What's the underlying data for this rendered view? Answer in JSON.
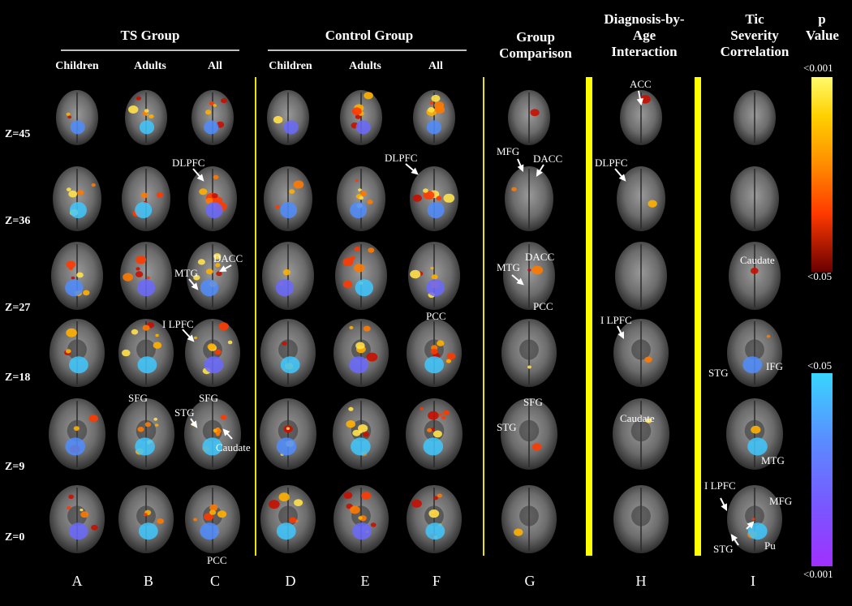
{
  "headers": {
    "ts_group": "TS Group",
    "control_group": "Control Group",
    "group_comparison": [
      "Group",
      "Comparison"
    ],
    "diagnosis_by_age": [
      "Diagnosis-by-",
      "Age",
      "Interaction"
    ],
    "tic_severity": [
      "Tic",
      "Severity",
      "Correlation"
    ],
    "p_value": [
      "p",
      "Value"
    ]
  },
  "subheaders": [
    "Children",
    "Adults",
    "All",
    "Children",
    "Adults",
    "All"
  ],
  "z_labels": [
    "Z=45",
    "Z=36",
    "Z=27",
    "Z=18",
    "Z=9",
    "Z=0"
  ],
  "column_letters": [
    "A",
    "B",
    "C",
    "D",
    "E",
    "F",
    "G",
    "H",
    "I"
  ],
  "colorbar": {
    "positive": {
      "top": "<0.001",
      "bottom": "<0.05",
      "colors": [
        "#fffb6a",
        "#ffd000",
        "#ff8c00",
        "#ff4a00",
        "#d01000",
        "#6a0000"
      ]
    },
    "negative": {
      "top": "<0.05",
      "bottom": "<0.001",
      "colors": [
        "#38d6ff",
        "#5a8cff",
        "#7a55ff",
        "#a030ff"
      ]
    }
  },
  "annotations": {
    "dlpfc_c": "DLPFC",
    "dacc_c": "DACC",
    "mtg_c": "MTG",
    "ilpfc_c": "I LPFC",
    "sfg_b": "SFG",
    "stg_c": "STG",
    "sfg_c": "SFG",
    "caudate_c": "Caudate",
    "pcc_c": "PCC",
    "dlpfc_f": "DLPFC",
    "pcc_f": "PCC",
    "mfg_g": "MFG",
    "dacc_g1": "DACC",
    "dacc_g2": "DACC",
    "mtg_g": "MTG",
    "pcc_g": "PCC",
    "sfg_g": "SFG",
    "stg_g": "STG",
    "acc_h": "ACC",
    "dlpfc_h": "DLPFC",
    "ilpfc_h": "I LPFC",
    "caudate_h": "Caudate",
    "caudate_i": "Caudate",
    "stg_i": "STG",
    "ifg_i": "IFG",
    "mtg_i": "MTG",
    "ilpfc_i": "I LPFC",
    "mfg_i": "MFG",
    "stg_i2": "STG",
    "pu_i": "Pu"
  }
}
